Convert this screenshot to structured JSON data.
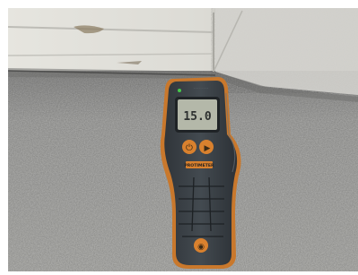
{
  "meter": {
    "reading": "15.0",
    "brand": "PROTIMETER"
  },
  "colors": {
    "frame": "#ffffff",
    "wall": "#a9a9a7",
    "ceiling": "#dcdbd6",
    "meter_body": "#3c4145",
    "meter_accent": "#d9812e",
    "lcd": "#b4b8a9",
    "power_led": "#45c94a"
  }
}
